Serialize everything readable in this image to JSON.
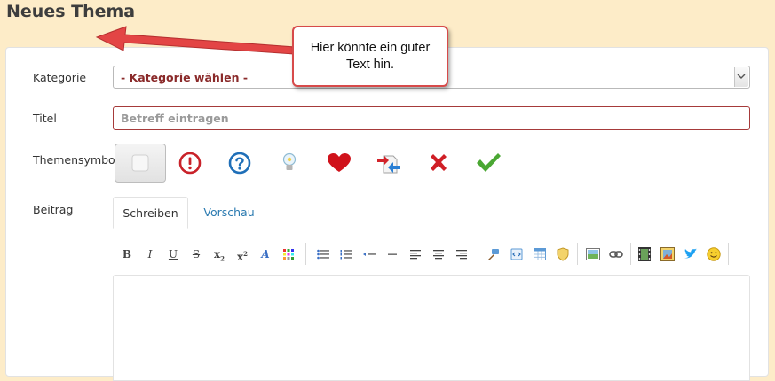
{
  "page_title": "Neues Thema",
  "form": {
    "category_label": "Kategorie",
    "category_value": "- Kategorie wählen -",
    "title_label": "Titel",
    "title_placeholder": "Betreff eintragen",
    "symbol_label": "Themensymbol",
    "symbols": [
      "none-icon",
      "exclamation-icon",
      "question-icon",
      "lightbulb-icon",
      "heart-icon",
      "move-icon",
      "cross-icon",
      "checkmark-icon"
    ],
    "post_label": "Beitrag"
  },
  "editor": {
    "tabs": [
      "Schreiben",
      "Vorschau"
    ],
    "toolbar": {
      "bold": "B",
      "italic": "I",
      "underline": "U",
      "strike": "S",
      "subscript": "x",
      "subscript_mark": "2",
      "superscript": "x",
      "superscript_mark": "2",
      "font": "A"
    }
  },
  "callout": {
    "text": "Hier könnte ein guter Text hin."
  },
  "colors": {
    "accent_red": "#d74a4a",
    "link_blue": "#2a7ab0",
    "background": "#fdecc8"
  }
}
